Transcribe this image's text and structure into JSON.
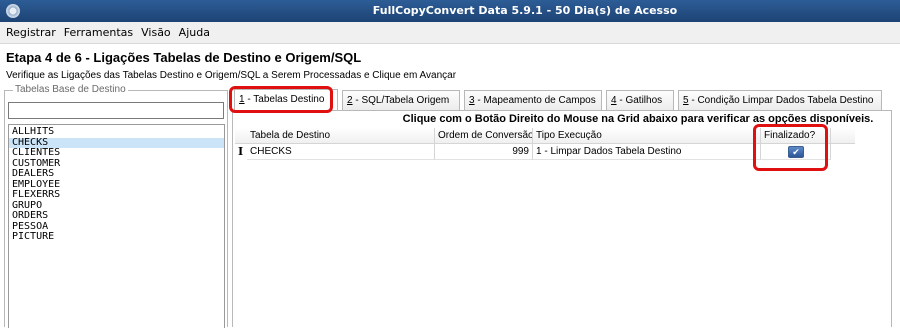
{
  "window": {
    "title": "FullCopyConvert Data 5.9.1 - 50 Dia(s) de Acesso",
    "icon": "app-gear-icon"
  },
  "menu": [
    "Registrar",
    "Ferramentas",
    "Visão",
    "Ajuda"
  ],
  "step": {
    "title": "Etapa 4 de 6 - Ligações Tabelas de Destino e Origem/SQL",
    "description": "Verifique as Ligações das Tabelas Destino e Origem/SQL a Serem Processadas e Clique em Avançar"
  },
  "left_panel": {
    "legend": "Tabelas Base de Destino",
    "filter_value": "",
    "tables": [
      "ALLHITS",
      "CHECKS",
      "CLIENTES",
      "CUSTOMER",
      "DEALERS",
      "EMPLOYEE",
      "FLEXERRS",
      "GRUPO",
      "ORDERS",
      "PESSOA",
      "PICTURE"
    ],
    "selected": "CHECKS"
  },
  "tabs": [
    {
      "key": "1",
      "label": " - Tabelas Destino",
      "active": true
    },
    {
      "key": "2",
      "label": " - SQL/Tabela Origem",
      "active": false
    },
    {
      "key": "3",
      "label": " - Mapeamento de Campos",
      "active": false
    },
    {
      "key": "4",
      "label": " - Gatilhos",
      "active": false
    },
    {
      "key": "5",
      "label": " - Condição Limpar Dados Tabela Destino",
      "active": false
    }
  ],
  "grid": {
    "hint": "Clique com o Botão Direito do Mouse na Grid abaixo para verificar as opções disponíveis.",
    "columns": [
      "Tabela de Destino",
      "Ordem de Conversão",
      "Tipo Execução",
      "Finalizado?"
    ],
    "rows": [
      {
        "indicator": "I",
        "tabela": "CHECKS",
        "ordem": "999",
        "tipo": "1 - Limpar Dados Tabela Destino",
        "finalizado": true
      }
    ]
  },
  "colors": {
    "titlebar": "#1d4374",
    "highlight": "#e01010",
    "selected_row": "#cce4f7"
  }
}
